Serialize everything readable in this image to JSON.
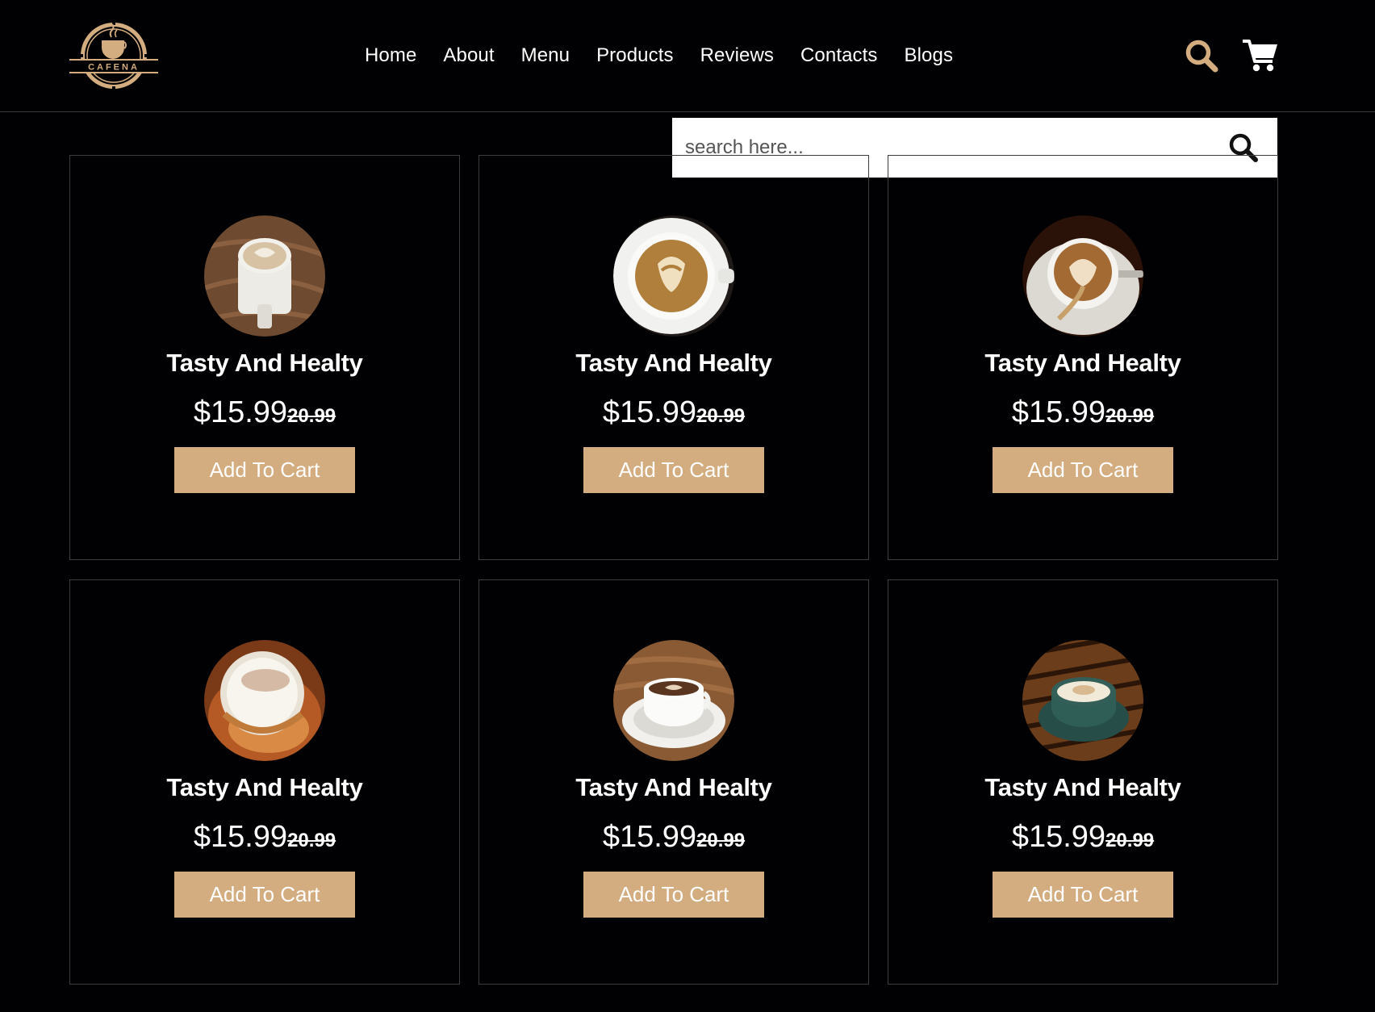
{
  "brand": {
    "logo_text": "CAFENA"
  },
  "nav": {
    "items": [
      {
        "label": "Home"
      },
      {
        "label": "About"
      },
      {
        "label": "Menu"
      },
      {
        "label": "Products"
      },
      {
        "label": "Reviews"
      },
      {
        "label": "Contacts"
      },
      {
        "label": "Blogs"
      }
    ]
  },
  "header_icons": {
    "search": "search-icon",
    "cart": "cart-icon"
  },
  "search": {
    "placeholder": "search here...",
    "value": ""
  },
  "colors": {
    "accent": "#d3ad7f",
    "background": "#010103",
    "border": "#3d3d3d"
  },
  "products": [
    {
      "title": "Tasty And Healty",
      "price": "$15.99",
      "old_price": "20.99",
      "button": "Add To Cart"
    },
    {
      "title": "Tasty And Healty",
      "price": "$15.99",
      "old_price": "20.99",
      "button": "Add To Cart"
    },
    {
      "title": "Tasty And Healty",
      "price": "$15.99",
      "old_price": "20.99",
      "button": "Add To Cart"
    },
    {
      "title": "Tasty And Healty",
      "price": "$15.99",
      "old_price": "20.99",
      "button": "Add To Cart"
    },
    {
      "title": "Tasty And Healty",
      "price": "$15.99",
      "old_price": "20.99",
      "button": "Add To Cart"
    },
    {
      "title": "Tasty And Healty",
      "price": "$15.99",
      "old_price": "20.99",
      "button": "Add To Cart"
    }
  ]
}
